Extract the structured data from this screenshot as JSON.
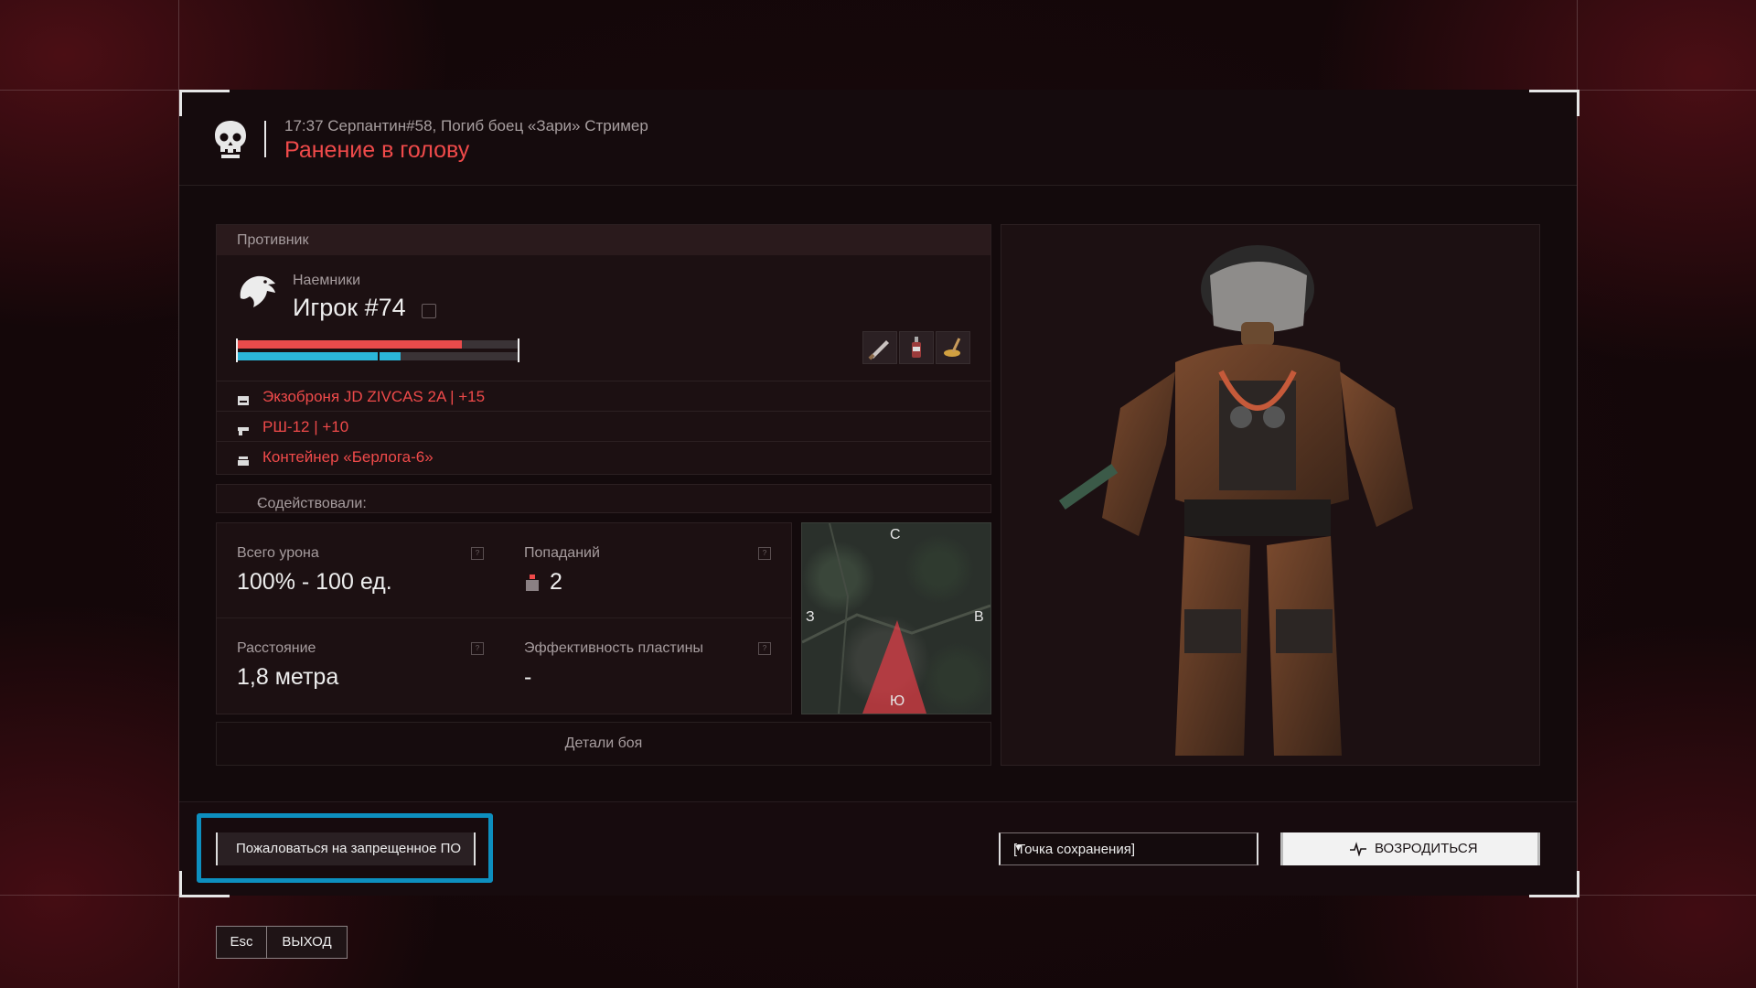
{
  "header": {
    "subtitle": "17:37 Серпантин#58, Погиб боец «Зари» Стример",
    "title": "Ранение в голову",
    "icon": "skull-icon"
  },
  "enemy": {
    "section_label": "Противник",
    "faction": "Наемники",
    "player_name": "Игрок #74",
    "health_fraction": 0.8,
    "armor_fraction": 0.58,
    "quick_items": [
      "knife-icon",
      "bottle-icon",
      "brush-icon"
    ],
    "equipment": [
      {
        "icon": "armor-icon",
        "label": "Экзоброня JD ZIVCAS 2A | +15"
      },
      {
        "icon": "gun-icon",
        "label": "РШ-12 | +10"
      },
      {
        "icon": "container-icon",
        "label": "Контейнер «Берлога-6»"
      }
    ]
  },
  "assist": {
    "label": "Содействовали:",
    "value": "-"
  },
  "stats": {
    "total_damage_label": "Всего урона",
    "total_damage_value": "100% - 100 ед.",
    "hits_label": "Попаданий",
    "hits_value": "2",
    "distance_label": "Расстояние",
    "distance_value": "1,8 метра",
    "plate_label": "Эффективность пластины",
    "plate_value": "-"
  },
  "minimap": {
    "north": "С",
    "south": "Ю",
    "west": "З",
    "east": "В"
  },
  "details_button": "Детали боя",
  "footer": {
    "report_button": "Пожаловаться на запрещенное ПО",
    "spawn_select": "[Точка сохранения]",
    "respawn_button": "ВОЗРОДИТЬСЯ",
    "esc_key": "Esc",
    "exit_label": "ВЫХОД"
  },
  "colors": {
    "accent_red": "#ef4a4a",
    "armor_blue": "#2bb6d9",
    "highlight_blue": "#0d8fbf"
  }
}
